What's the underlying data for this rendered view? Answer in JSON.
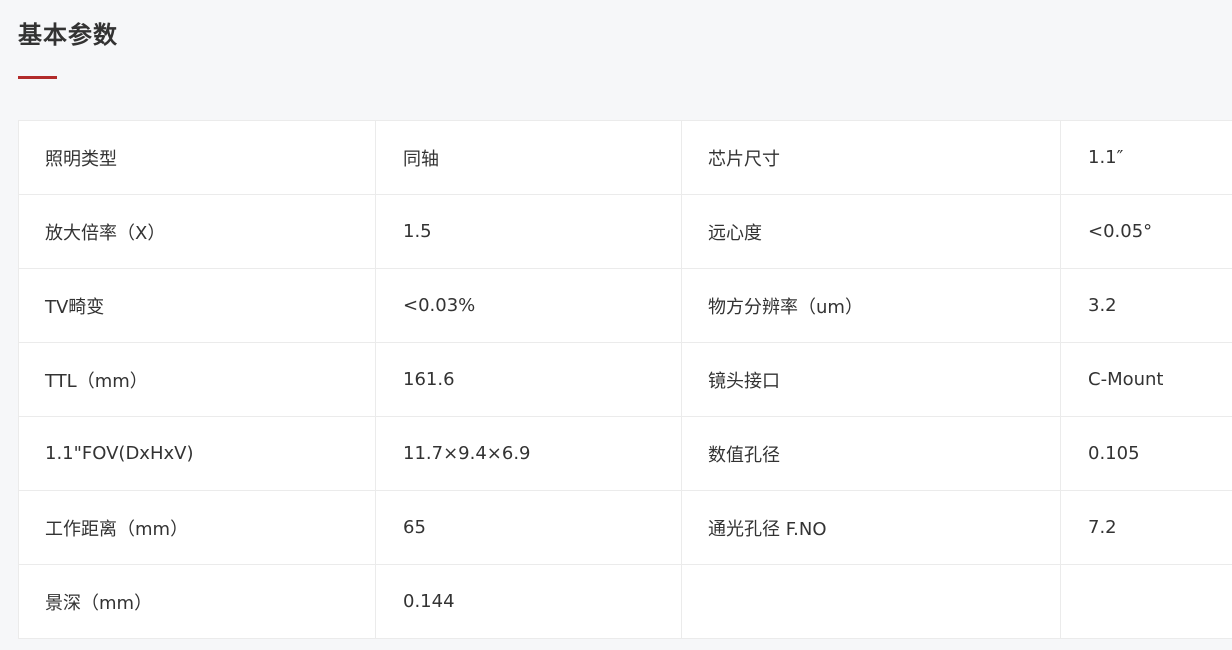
{
  "section": {
    "title": "基本参数",
    "accent_color": "#b22b2b"
  },
  "specs": {
    "rows": [
      {
        "label1": "照明类型",
        "value1": "同轴",
        "label2": "芯片尺寸",
        "value2": "1.1″"
      },
      {
        "label1": "放大倍率（X）",
        "value1": "1.5",
        "label2": "远心度",
        "value2": "<0.05°"
      },
      {
        "label1": "TV畸变",
        "value1": "<0.03%",
        "label2": "物方分辨率（um）",
        "value2": "3.2"
      },
      {
        "label1": "TTL（mm）",
        "value1": "161.6",
        "label2": "镜头接口",
        "value2": "C-Mount"
      },
      {
        "label1": "1.1\"FOV(DxHxV)",
        "value1": "11.7×9.4×6.9",
        "label2": "数值孔径",
        "value2": "0.105"
      },
      {
        "label1": "工作距离（mm）",
        "value1": "65",
        "label2": "通光孔径 F.NO",
        "value2": "7.2"
      },
      {
        "label1": "景深（mm）",
        "value1": "0.144",
        "label2": "",
        "value2": ""
      }
    ]
  }
}
